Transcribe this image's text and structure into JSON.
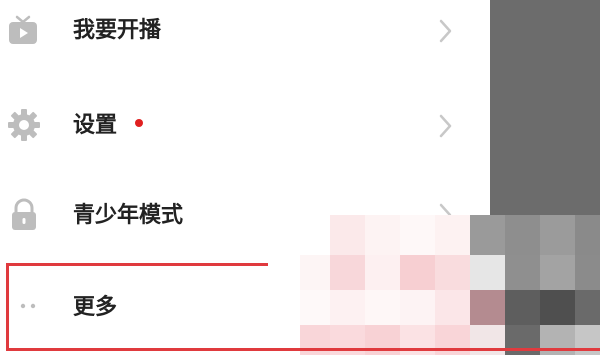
{
  "menu": {
    "items": [
      {
        "label": "我要开播",
        "icon": "live-tv-icon",
        "chevron": true
      },
      {
        "label": "设置",
        "icon": "gear-icon",
        "chevron": true,
        "badge_color": "#e02020"
      },
      {
        "label": "青少年模式",
        "icon": "lock-icon",
        "chevron": true
      },
      {
        "label": "更多",
        "icon": "more-dots-icon",
        "chevron": false
      }
    ]
  },
  "colors": {
    "highlight": "#e03a3e",
    "badge": "#e02020",
    "side_panel": "#6c6c6c"
  }
}
